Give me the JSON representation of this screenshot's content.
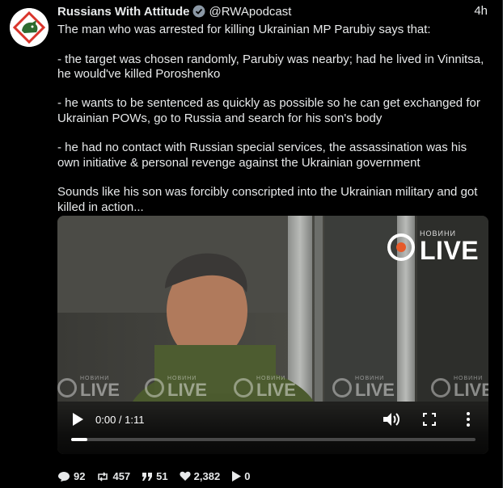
{
  "post": {
    "author_name": "Russians With Attitude",
    "handle": "@RWApodcast",
    "time": "4h",
    "paragraphs": [
      "The man who was arrested for killing Ukrainian MP Parubiy says that:",
      "- the target was chosen randomly, Parubiy was nearby; had he lived in Vinnitsa, he would've killed Poroshenko",
      "- he wants to be sentenced as quickly as possible so he can get exchanged for Ukrainian POWs, go to Russia and search for his son's body",
      "- he had no contact with Russian special services, the assassination was his own initiative & personal revenge against the Ukrainian government",
      "Sounds like his son was forcibly conscripted into the Ukrainian military and got killed in action..."
    ]
  },
  "video": {
    "channel_small": "НОВИНИ",
    "channel_big": "LIVE",
    "watermark_small": "НОВИНИ",
    "watermark_big": "LIVE",
    "timecode": "0:00 / 1:11",
    "progress": 0.04
  },
  "stats": {
    "replies": "92",
    "reposts": "457",
    "quotes": "51",
    "likes": "2,382",
    "views": "0"
  },
  "colors": {
    "background": "#000000",
    "text": "#e7e9ea",
    "verified": "#8b98a5",
    "live_accent": "#e65a2a"
  },
  "icons": [
    "avatar-logo-icon",
    "verified-badge-icon",
    "play-icon",
    "volume-icon",
    "fullscreen-icon",
    "more-vertical-icon",
    "reply-icon",
    "repost-icon",
    "quote-icon",
    "like-icon",
    "views-play-icon"
  ]
}
